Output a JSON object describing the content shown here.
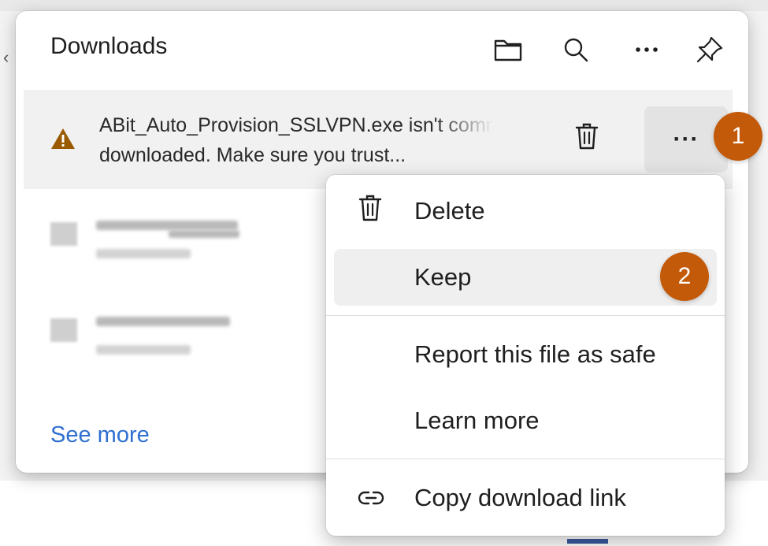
{
  "panel": {
    "title": "Downloads",
    "header_icons": [
      "folder-icon",
      "search-icon",
      "more-icon",
      "pin-icon"
    ],
    "more_dots": "···",
    "see_more": "See more"
  },
  "warning_item": {
    "line1": "ABit_Auto_Provision_SSLVPN.exe isn't commonly",
    "line2": "downloaded. Make sure you trust...",
    "icon": "warning-icon",
    "delete_icon": "trash-icon",
    "more_label": "···"
  },
  "menu": {
    "items": [
      {
        "label": "Delete",
        "icon": "trash-icon"
      },
      {
        "label": "Keep",
        "icon": ""
      },
      {
        "label": "Report this file as safe",
        "icon": ""
      },
      {
        "label": "Learn more",
        "icon": ""
      },
      {
        "label": "Copy download link",
        "icon": "link-icon"
      }
    ]
  },
  "badges": {
    "step1": "1",
    "step2": "2"
  },
  "colors": {
    "accent_link": "#2e6fd1",
    "badge": "#c35a0a",
    "warning": "#9a5b00"
  }
}
